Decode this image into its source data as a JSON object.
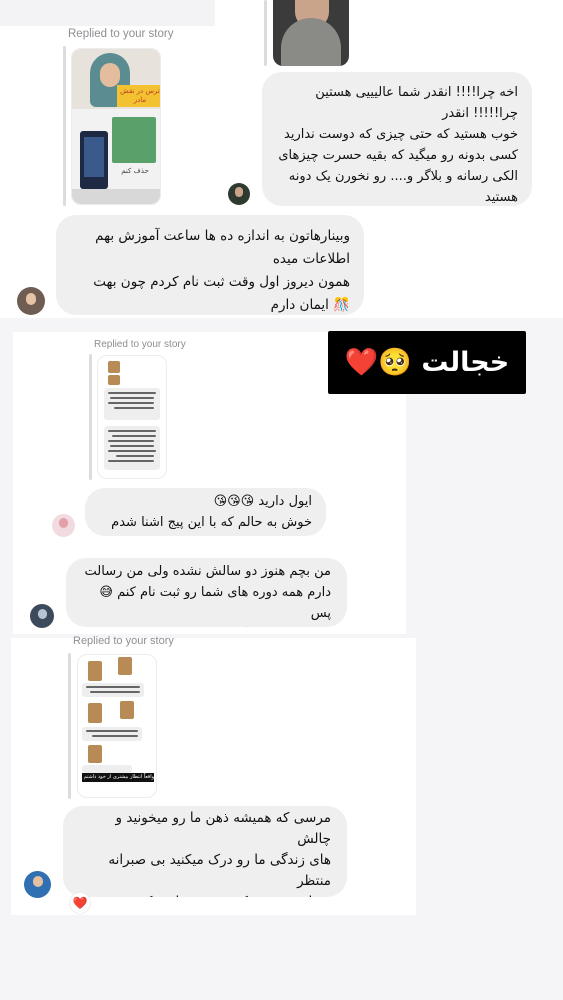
{
  "conversations": {
    "one": {
      "story_reply_label": "Replied to your story",
      "outgoing_message": "اخه چرا!!!! انقدر شما عالیییی هستین چرا!!!!! انقدر\nخوب هستید که حتی چیزی که دوست ندارید\nکسی بدونه رو میگید که بقیه حسرت چیزهای\nالکی رسانه و بلاگر و.... رو نخورن یک دونه هستید\nخانم دکتر یک دونهههههههه 😘عشقید بخدا!!!!\n💜 نور توی لحظه لحظه ی زندگیتون بتابه 🥰🥰",
      "incoming_message": "وبینارهاتون به اندازه ده ها ساعت آموزش بهم\nاطلاعات میده\nهمون دیروز اول وقت ثبت نام کردم چون بهت\n🎊 ایمان دارم",
      "story_card_title": "ترس در نقش مادر",
      "story_card_subtitle": "حذف کنم"
    },
    "two": {
      "story_reply_label": "Replied to your story",
      "caption_sticker": "خجالت 🥺❤️",
      "message_a": "ایول دارید 😘😘😘\nخوش به حالم که با این پیج اشنا شدم 😍😘",
      "message_b": "من بچم هنوز دو سالش نشده ولی من رسالت\nدارم همه دوره های شما رو ثبت نام کنم 😅پس\nثبت نام کردم 🤭"
    },
    "three": {
      "story_reply_label": "Replied to your story",
      "story_caption": "واقعاً انتظار بیشتری از خود داشتم 🤩",
      "message": "مرسی که همیشه ذهن ما رو میخونید و چالش\nهای زندگی ما رو درک میکنید بی صبرانه منتظر\nوبینارم مرسی که هستین خانم دکتر عزیز و\nدوست داشتنی",
      "reaction": "❤️"
    }
  },
  "colors": {
    "bubble": "#efefef",
    "meta_text": "#8e8e93",
    "sticker_bg": "#000000",
    "sticker_text": "#ffffff"
  }
}
